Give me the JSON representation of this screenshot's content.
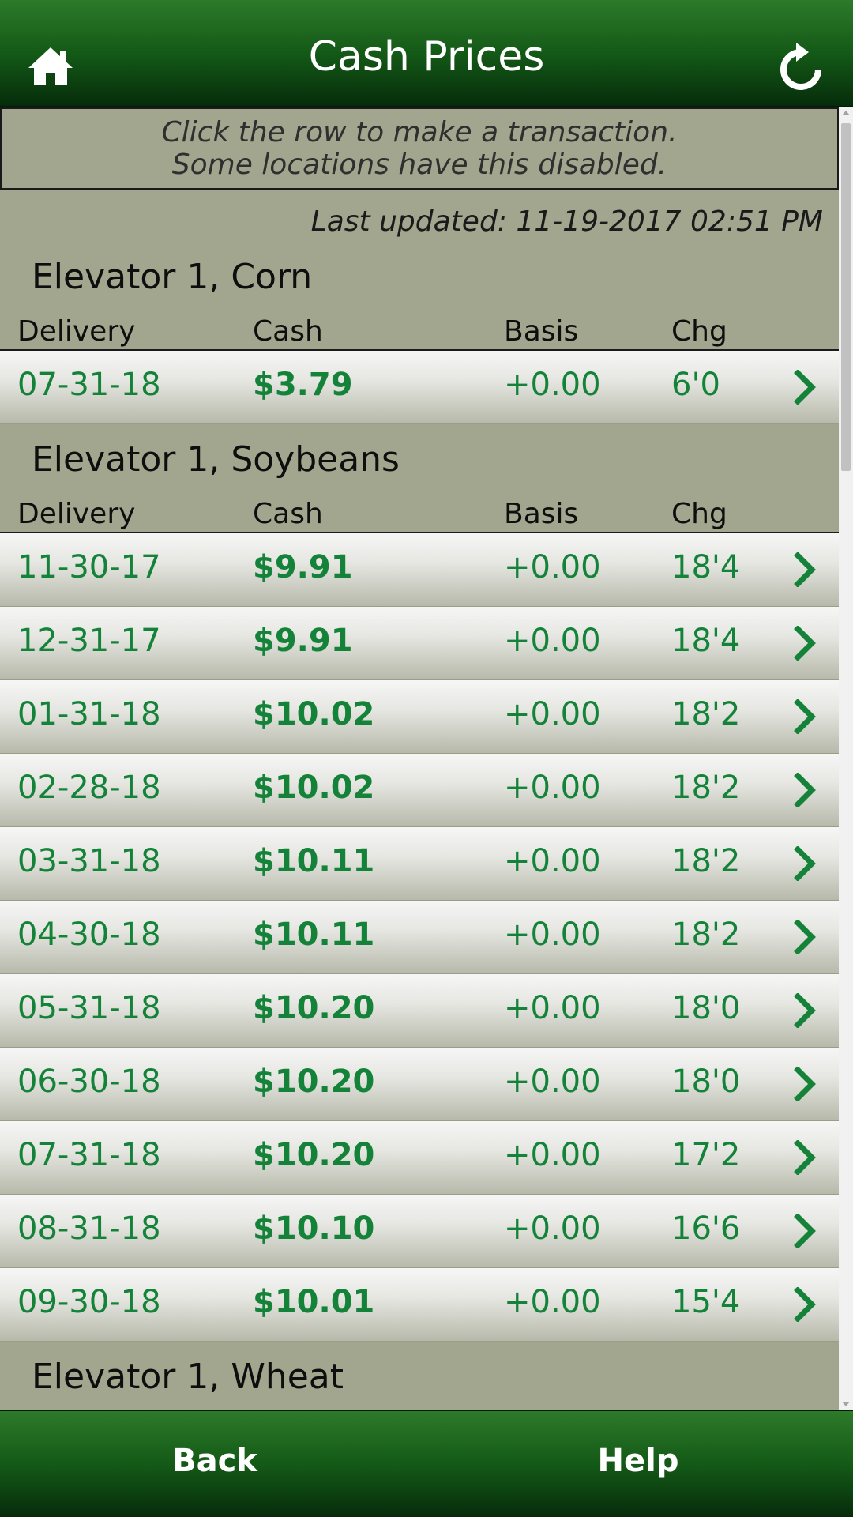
{
  "header": {
    "title": "Cash Prices",
    "home_icon": "home-icon",
    "refresh_icon": "refresh-icon"
  },
  "notice": {
    "line1": "Click the row to make a transaction.",
    "line2": "Some locations have this disabled."
  },
  "last_updated": "Last updated: 11-19-2017 02:51 PM",
  "columns": {
    "delivery": "Delivery",
    "cash": "Cash",
    "basis": "Basis",
    "chg": "Chg"
  },
  "sections": [
    {
      "title": "Elevator 1, Corn",
      "rows": [
        {
          "delivery": "07-31-18",
          "cash": "$3.79",
          "basis": "+0.00",
          "chg": "6'0"
        }
      ]
    },
    {
      "title": "Elevator 1, Soybeans",
      "rows": [
        {
          "delivery": "11-30-17",
          "cash": "$9.91",
          "basis": "+0.00",
          "chg": "18'4"
        },
        {
          "delivery": "12-31-17",
          "cash": "$9.91",
          "basis": "+0.00",
          "chg": "18'4"
        },
        {
          "delivery": "01-31-18",
          "cash": "$10.02",
          "basis": "+0.00",
          "chg": "18'2"
        },
        {
          "delivery": "02-28-18",
          "cash": "$10.02",
          "basis": "+0.00",
          "chg": "18'2"
        },
        {
          "delivery": "03-31-18",
          "cash": "$10.11",
          "basis": "+0.00",
          "chg": "18'2"
        },
        {
          "delivery": "04-30-18",
          "cash": "$10.11",
          "basis": "+0.00",
          "chg": "18'2"
        },
        {
          "delivery": "05-31-18",
          "cash": "$10.20",
          "basis": "+0.00",
          "chg": "18'0"
        },
        {
          "delivery": "06-30-18",
          "cash": "$10.20",
          "basis": "+0.00",
          "chg": "18'0"
        },
        {
          "delivery": "07-31-18",
          "cash": "$10.20",
          "basis": "+0.00",
          "chg": "17'2"
        },
        {
          "delivery": "08-31-18",
          "cash": "$10.10",
          "basis": "+0.00",
          "chg": "16'6"
        },
        {
          "delivery": "09-30-18",
          "cash": "$10.01",
          "basis": "+0.00",
          "chg": "15'4"
        }
      ]
    },
    {
      "title": "Elevator 1, Wheat",
      "rows": []
    }
  ],
  "footer": {
    "back": "Back",
    "help": "Help"
  },
  "colors": {
    "accent_green": "#148339",
    "header_green": "#145a17",
    "background": "#a3a68e"
  }
}
